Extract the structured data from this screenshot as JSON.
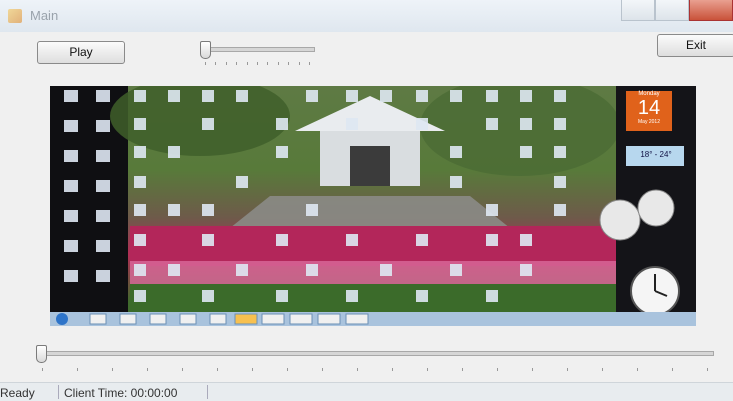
{
  "window": {
    "title": "Main"
  },
  "controls": {
    "play_label": "Play",
    "exit_label": "Exit"
  },
  "volume_slider": {
    "value_fraction": 0.0
  },
  "seek_slider": {
    "value_fraction": 0.0
  },
  "video": {
    "calendar_month": "Monday",
    "calendar_day": "14",
    "calendar_sub": "May 2012",
    "weather": "18° - 24°"
  },
  "status": {
    "ready": "Ready",
    "client_time": "Client Time:  00:00:00"
  }
}
